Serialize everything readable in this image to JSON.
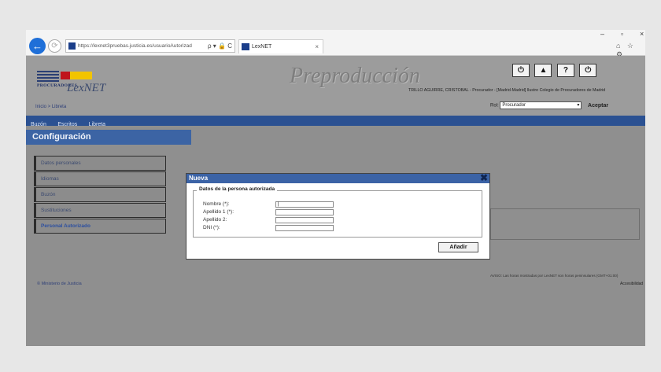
{
  "browser": {
    "url": "https://lexnet3pruebas.justicia.es/usuarioAutorizad",
    "url_icons": "ρ ▾ 🔒 C",
    "tab_title": "LexNET",
    "tab_close": "×",
    "win_min": "–",
    "win_max": "▫",
    "win_close": "×",
    "tools": "⌂ ☆ ⚙",
    "back_icon": "←",
    "forward_icon": "⟳"
  },
  "header": {
    "logo_proc": "PROCURADORES",
    "logo_lexnet": "LexNET",
    "env_label": "Preproducción",
    "buttons": [
      "⏻",
      "▲",
      "?",
      "⏻"
    ],
    "user_info": "TRILLO AGUIRRE, CRISTOBAL - Procurador - [Madrid-Madrid] Ilustre Colegio de Procuradores de Madrid",
    "rol_label": "Rol:",
    "rol_value": "Procurador",
    "rol_chevron": "▾",
    "aceptar": "Aceptar",
    "breadcrumb": "Inicio > Libreta"
  },
  "nav": [
    "Buzón",
    "Escritos",
    "Libreta"
  ],
  "config_title": "Configuración",
  "sidebar": [
    "Datos personales",
    "Idiomas",
    "Buzón",
    "Sustituciones",
    "Personal Autorizado"
  ],
  "footer": {
    "warning": "AVISO: Las horas mostradas por LexNET son horas peninsulares (GMT+01:00)",
    "accesibilidad": "Accesibilidad",
    "ministerio": "© Ministerio de Justicia"
  },
  "modal": {
    "title": "Nueva",
    "close": "✖",
    "legend": "Datos de la persona autorizada",
    "fields": [
      {
        "label": "Nombre (*):",
        "value": "|"
      },
      {
        "label": "Apellido 1 (*):",
        "value": ""
      },
      {
        "label": "Apellido 2:",
        "value": ""
      },
      {
        "label": "DNI (*):",
        "value": ""
      }
    ],
    "add_button": "Añadir"
  }
}
